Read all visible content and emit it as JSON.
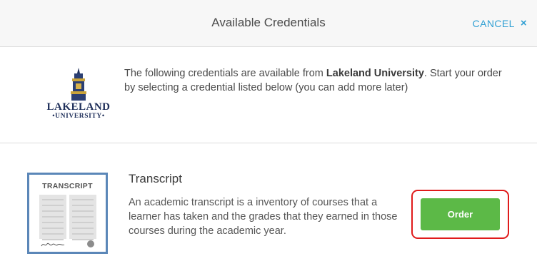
{
  "header": {
    "title": "Available Credentials",
    "cancel_label": "CANCEL",
    "cancel_icon": "×"
  },
  "intro": {
    "logo": {
      "name": "LAKELAND",
      "sub": "•UNIVERSITY•"
    },
    "text_before": "The following credentials are available from ",
    "institution": "Lakeland University",
    "text_after": ". Start your order by selecting a credential listed below (you can add more later)"
  },
  "credential": {
    "thumbnail_title": "TRANSCRIPT",
    "title": "Transcript",
    "description": "An academic transcript is a inventory of courses that a learner has taken and the grades that they earned in those courses during the academic year.",
    "order_label": "Order"
  },
  "colors": {
    "accent": "#2f9fd3",
    "order_button": "#5cb947",
    "highlight": "#e01b1b",
    "thumbnail_border": "#5b87b8"
  }
}
